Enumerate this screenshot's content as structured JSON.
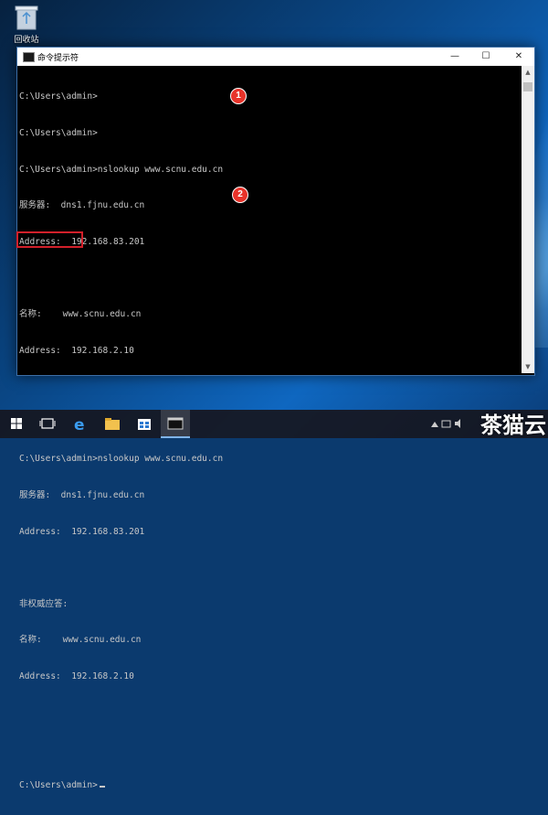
{
  "desktop": {
    "recycle_bin_label": "回收站"
  },
  "window": {
    "title": "命令提示符",
    "minimize": "—",
    "maximize": "☐",
    "close": "✕"
  },
  "console": {
    "lines": [
      "C:\\Users\\admin>",
      "C:\\Users\\admin>",
      "C:\\Users\\admin>nslookup www.scnu.edu.cn",
      "服务器:  dns1.fjnu.edu.cn",
      "Address:  192.168.83.201",
      "",
      "名称:    www.scnu.edu.cn",
      "Address:  192.168.2.10",
      "",
      "",
      "C:\\Users\\admin>nslookup www.scnu.edu.cn",
      "服务器:  dns1.fjnu.edu.cn",
      "Address:  192.168.83.201",
      "",
      "非权威应答:",
      "名称:    www.scnu.edu.cn",
      "Address:  192.168.2.10",
      "",
      "",
      "C:\\Users\\admin>"
    ]
  },
  "annotations": {
    "badge_1": "1",
    "badge_2": "2"
  },
  "taskbar": {
    "items": [
      "start",
      "task-view",
      "edge",
      "file-explorer",
      "store",
      "command-prompt"
    ]
  },
  "watermark": "茶猫云"
}
